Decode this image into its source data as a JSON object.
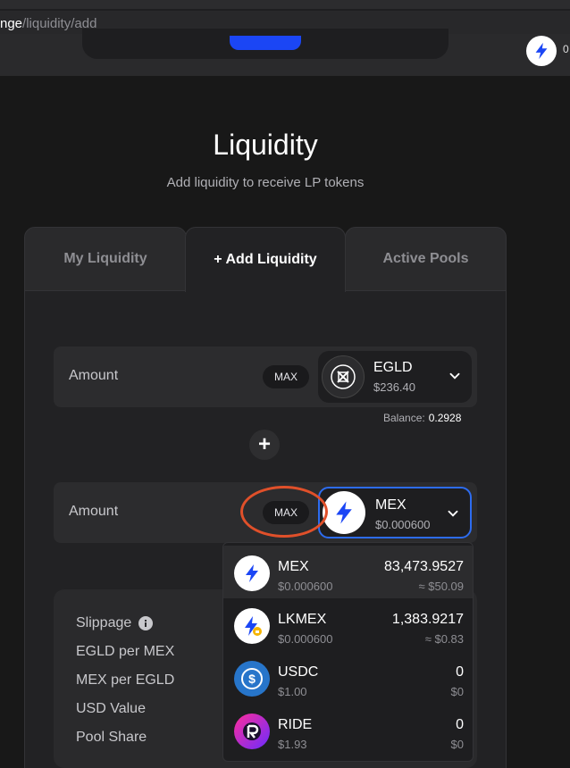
{
  "browser": {
    "url_host_fragment": "nge",
    "url_path": "/liquidity/add"
  },
  "header": {
    "account_text": "0"
  },
  "page": {
    "title": "Liquidity",
    "subtitle": "Add liquidity to receive LP tokens"
  },
  "tabs": [
    {
      "label": "My Liquidity"
    },
    {
      "label": "+ Add Liquidity"
    },
    {
      "label": "Active Pools"
    }
  ],
  "first_input": {
    "label": "Amount",
    "max_label": "MAX",
    "token": "EGLD",
    "token_price": "$236.40",
    "balance_label": "Balance:",
    "balance_value": "0.2928"
  },
  "plus_symbol": "+",
  "second_input": {
    "label": "Amount",
    "max_label": "MAX",
    "token": "MEX",
    "token_price": "$0.000600"
  },
  "info": {
    "rows": [
      {
        "label": "Slippage"
      },
      {
        "label": "EGLD per MEX"
      },
      {
        "label": "MEX per EGLD"
      },
      {
        "label": "USD Value"
      },
      {
        "label": "Pool Share"
      }
    ]
  },
  "dropdown": {
    "items": [
      {
        "name": "MEX",
        "price": "$0.000600",
        "balance": "83,473.9527",
        "usd": "≈ $50.09",
        "icon": "mex-icon"
      },
      {
        "name": "LKMEX",
        "price": "$0.000600",
        "balance": "1,383.9217",
        "usd": "≈ $0.83",
        "icon": "lkmex-icon"
      },
      {
        "name": "USDC",
        "price": "$1.00",
        "balance": "0",
        "usd": "$0",
        "icon": "usdc-icon"
      },
      {
        "name": "RIDE",
        "price": "$1.93",
        "balance": "0",
        "usd": "$0",
        "icon": "ride-icon"
      }
    ]
  },
  "colors": {
    "accent": "#1b46f5",
    "focus_border": "#2d6cf0",
    "annotation": "#e0502a",
    "background": "#181818"
  }
}
